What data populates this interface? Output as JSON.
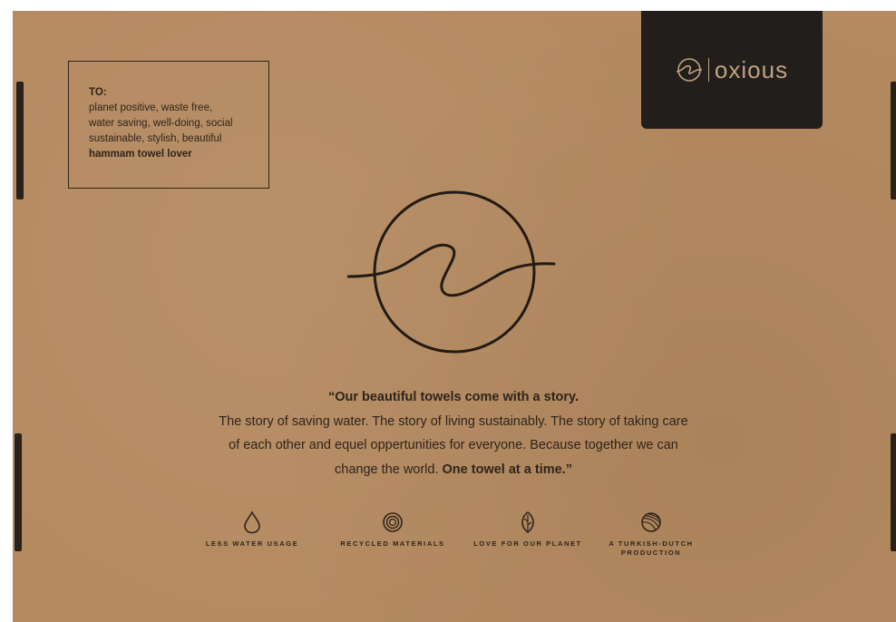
{
  "address_label": {
    "to": "TO:",
    "lines": [
      "planet positive, waste free,",
      "water saving, well-doing, social",
      "sustainable, stylish, beautiful"
    ],
    "emphasis": "hammam towel lover"
  },
  "brand": {
    "name": "oxious"
  },
  "story": {
    "headline": "“Our beautiful towels come with a story.",
    "line1": "The story of saving water. The story of living sustainably. The story of taking care",
    "line2": "of each other and equel oppertunities for everyone. Because together we can",
    "line3_start": "change the world.",
    "line3_emphasis": "One towel at a time.”"
  },
  "features": [
    {
      "icon": "water-drop-icon",
      "label": "LESS WATER USAGE"
    },
    {
      "icon": "recycle-circle-icon",
      "label": "RECYCLED MATERIALS"
    },
    {
      "icon": "leaf-icon",
      "label": "LOVE FOR OUR PLANET"
    },
    {
      "icon": "yarn-ball-icon",
      "label": "A TURKISH-DUTCH PRODUCTION"
    }
  ],
  "colors": {
    "cardboard": "#b48a60",
    "ink": "#2f241b",
    "brand_bg": "#211e1c",
    "brand_text": "#c0a27e"
  }
}
